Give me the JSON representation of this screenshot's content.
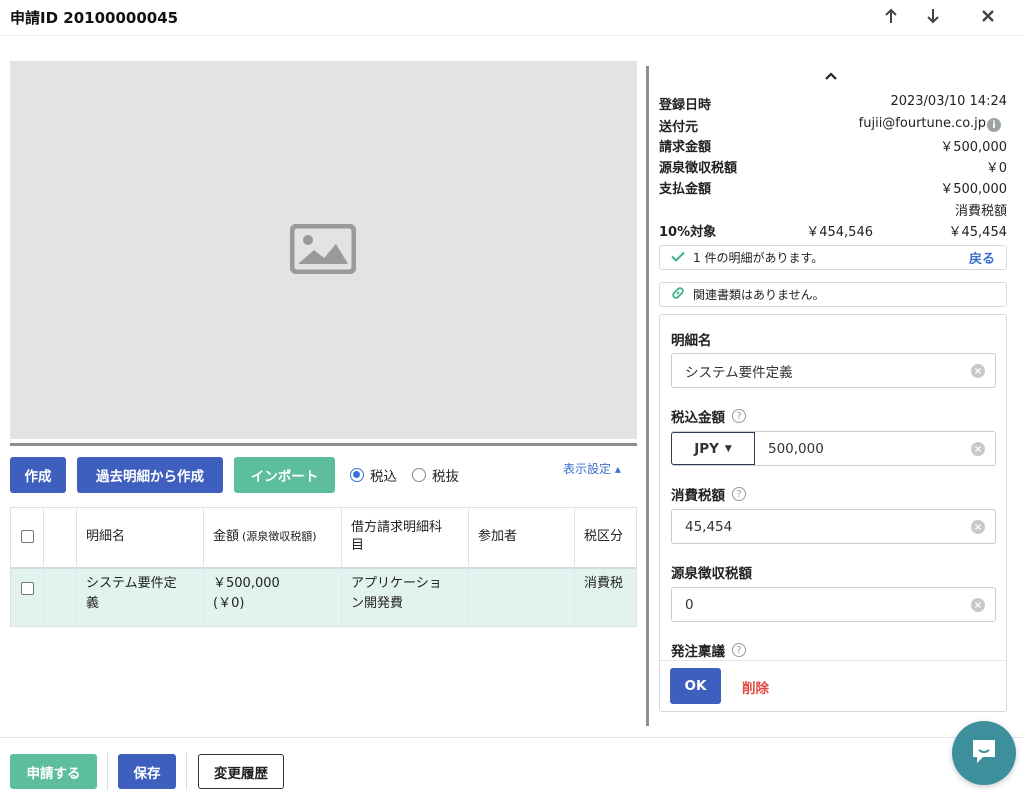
{
  "header": {
    "title": "申請ID 20100000045",
    "icons": [
      "arrow-up-icon",
      "arrow-down-icon",
      "close-icon"
    ]
  },
  "toolbar": {
    "create": "作成",
    "create_from_past": "過去明細から作成",
    "import": "インポート",
    "tax_included": "税込",
    "tax_excluded": "税抜",
    "tax_mode_selected": "税込",
    "display_settings": "表示設定 ▴"
  },
  "table": {
    "headers": [
      "明細名",
      "金額",
      "(源泉徴収税額)",
      "借方請求明細科",
      "目",
      "参加者",
      "税区分"
    ],
    "rows": [
      {
        "name_line1": "システム要件定",
        "name_line2": "義",
        "amount": "￥500,000",
        "withholding": "(￥0)",
        "account_line1": "アプリケーショ",
        "account_line2": "ン開発費",
        "participant": "",
        "tax_category": "消費税"
      }
    ]
  },
  "info": {
    "registered_label": "登録日時",
    "registered_value": "2023/03/10 14:24",
    "sender_label": "送付元",
    "sender_value": "fujii@fourtune.co.jp",
    "invoice_amount_label": "請求金額",
    "invoice_amount_value": "￥500,000",
    "withholding_label": "源泉徴収税額",
    "withholding_value": "￥0",
    "payment_label": "支払金額",
    "payment_value": "￥500,000",
    "consumption_tax_label": "消費税額",
    "ten_percent_label": "10%対象",
    "ten_percent_base": "￥454,546",
    "ten_percent_tax": "￥45,454"
  },
  "notices": {
    "details_count": "1 件の明細があります。",
    "back": "戻る",
    "no_related_docs": "関連書類はありません。"
  },
  "form": {
    "detail_name_label": "明細名",
    "detail_name_value": "システム要件定義",
    "tax_included_amount_label": "税込金額",
    "currency": "JPY",
    "amount_value": "500,000",
    "consumption_tax_label": "消費税額",
    "consumption_tax_value": "45,454",
    "withholding_label": "源泉徴収税額",
    "withholding_value": "0",
    "order_proposal_label": "発注稟議",
    "ok": "OK",
    "delete": "削除"
  },
  "footer": {
    "submit": "申請する",
    "save": "保存",
    "history": "変更履歴"
  },
  "colors": {
    "primary": "#3f5fbe",
    "green": "#5cbd9f",
    "danger": "#e0473d",
    "link": "#3b6fd0",
    "chat": "#3d8f9c"
  }
}
